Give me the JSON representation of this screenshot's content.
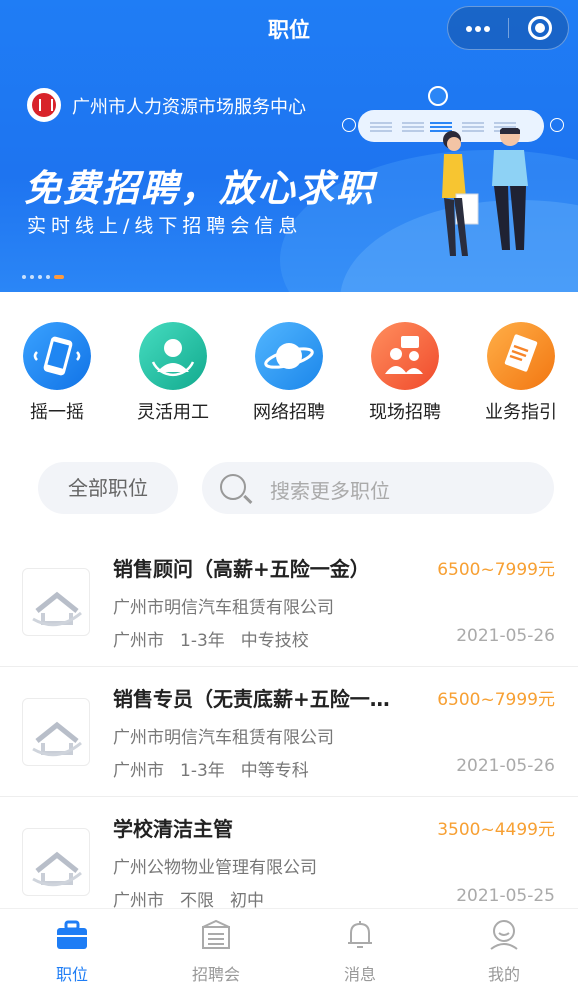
{
  "header": {
    "title": "职位"
  },
  "banner": {
    "org_name": "广州市人力资源市场服务中心",
    "slogan": "免费招聘，放心求职",
    "subtitle": "实时线上/线下招聘会信息"
  },
  "quick_actions": [
    {
      "label": "摇一摇",
      "icon": "phone-shake-icon",
      "color": "#1f86f2"
    },
    {
      "label": "灵活用工",
      "icon": "worker-icon",
      "color": "#22c2a5"
    },
    {
      "label": "网络招聘",
      "icon": "planet-icon",
      "color": "#2e9cf4"
    },
    {
      "label": "现场招聘",
      "icon": "people-chat-icon",
      "color": "#f6623e"
    },
    {
      "label": "业务指引",
      "icon": "document-icon",
      "color": "#f78c28"
    }
  ],
  "filter": {
    "all_jobs_label": "全部职位"
  },
  "search": {
    "placeholder": "搜索更多职位"
  },
  "jobs": [
    {
      "title": "销售顾问（高薪+五险一金）",
      "salary": "6500~7999元",
      "company": "广州市明信汽车租赁有限公司",
      "city": "广州市",
      "experience": "1-3年",
      "education": "中专技校",
      "date": "2021-05-26"
    },
    {
      "title": "销售专员（无责底薪+五险一…",
      "salary": "6500~7999元",
      "company": "广州市明信汽车租赁有限公司",
      "city": "广州市",
      "experience": "1-3年",
      "education": "中等专科",
      "date": "2021-05-26"
    },
    {
      "title": "学校清洁主管",
      "salary": "3500~4499元",
      "company": "广州公物物业管理有限公司",
      "city": "广州市",
      "experience": "不限",
      "education": "初中",
      "date": "2021-05-25"
    }
  ],
  "tabs": [
    {
      "label": "职位",
      "icon": "briefcase-icon",
      "active": true
    },
    {
      "label": "招聘会",
      "icon": "job-fair-icon",
      "active": false
    },
    {
      "label": "消息",
      "icon": "bell-icon",
      "active": false
    },
    {
      "label": "我的",
      "icon": "profile-icon",
      "active": false
    }
  ],
  "colors": {
    "brand_blue": "#1e7df5",
    "salary_orange": "#f7a033"
  }
}
